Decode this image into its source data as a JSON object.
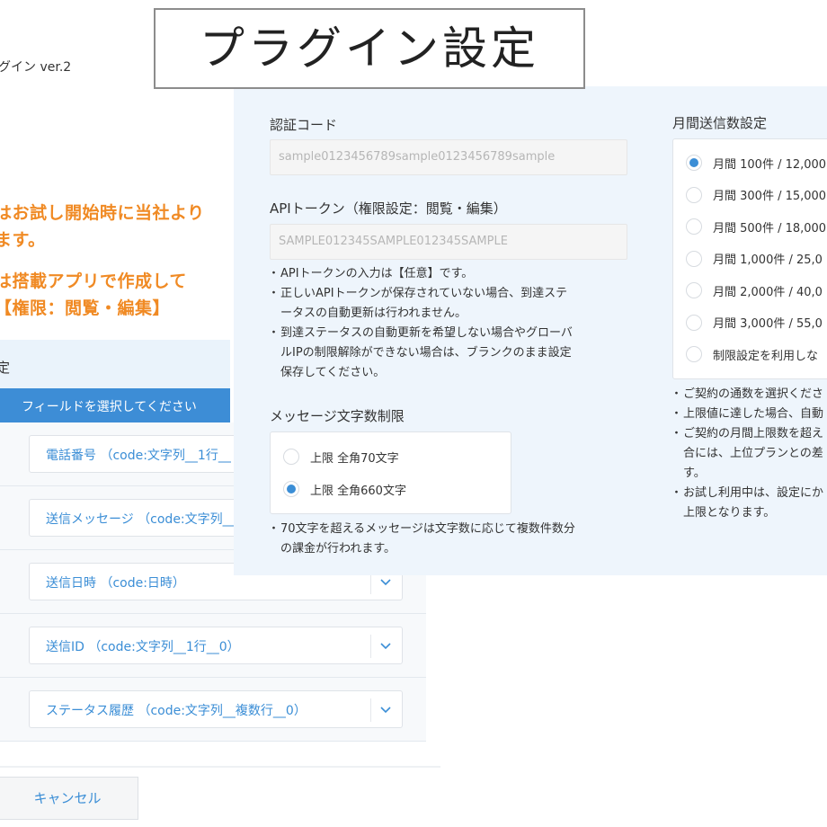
{
  "title_overlay": "プラグイン設定",
  "background": {
    "app_title": "グイン ver.2",
    "orange_para1": [
      "はお試し開始時に当社より",
      "ます。"
    ],
    "orange_para2": [
      "は搭載アプリで作成して",
      "【権限：閲覧・編集】"
    ],
    "settings_heading": "定",
    "field_header": "フィールドを選択してください",
    "field_rows": [
      "電話番号 （code:文字列__1行__",
      "送信メッセージ （code:文字列__",
      "送信日時 （code:日時）",
      "送信ID （code:文字列__1行__0）",
      "ステータス履歴 （code:文字列__複数行__0）"
    ],
    "cancel_label": "キャンセル"
  },
  "settings": {
    "auth_code_label": "認証コード",
    "auth_code_value": "sample0123456789sample0123456789sample",
    "api_token_label": "APIトークン（権限設定：閲覧・編集）",
    "api_token_value": "SAMPLE012345SAMPLE012345SAMPLE",
    "api_notes": [
      "APIトークンの入力は【任意】です。",
      "正しいAPIトークンが保存されていない場合、到達ステ\nータスの自動更新は行われません。",
      "到達ステータスの自動更新を希望しない場合やグローバ\nルIPの制限解除ができない場合は、ブランクのまま設定\n保存してください。"
    ],
    "message_limit_label": "メッセージ文字数制限",
    "message_limit_options": [
      {
        "label": "上限 全角70文字",
        "checked": false
      },
      {
        "label": "上限 全角660文字",
        "checked": true
      }
    ],
    "message_notes": [
      "70文字を超えるメッセージは文字数に応じて複数件数分\nの課金が行われます。"
    ],
    "monthly_label": "月間送信数設定",
    "monthly_options": [
      {
        "label": "月間 100件 / 12,000",
        "checked": true
      },
      {
        "label": "月間 300件 / 15,000",
        "checked": false
      },
      {
        "label": "月間 500件 / 18,000",
        "checked": false
      },
      {
        "label": "月間 1,000件 / 25,0",
        "checked": false
      },
      {
        "label": "月間 2,000件 / 40,0",
        "checked": false
      },
      {
        "label": "月間 3,000件 / 55,0",
        "checked": false
      },
      {
        "label": "制限設定を利用しな",
        "checked": false
      }
    ],
    "monthly_notes": [
      "ご契約の通数を選択くださ",
      "上限値に達した場合、自動",
      "ご契約の月間上限数を超え\n合には、上位プランとの差\nす。",
      "お試し利用中は、設定にか\n上限となります。"
    ]
  }
}
